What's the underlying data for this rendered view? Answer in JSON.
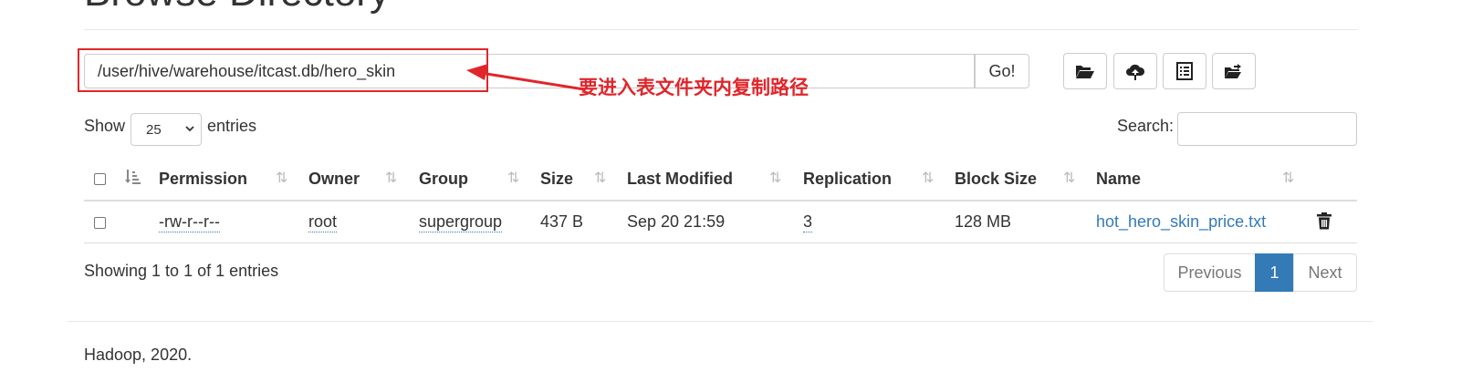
{
  "header": {
    "title": "Browse Directory"
  },
  "pathbar": {
    "path_value": "/user/hive/warehouse/itcast.db/hero_skin",
    "go_label": "Go!"
  },
  "annotation": {
    "text": "要进入表文件夹内复制路径",
    "color": "#e0262b"
  },
  "toolbar": {
    "icons": [
      "folder-open-icon",
      "cloud-upload-icon",
      "list-icon",
      "move-folder-icon"
    ]
  },
  "table_controls": {
    "show_label": "Show",
    "entries_value": "25",
    "entries_label": "entries",
    "search_label": "Search:"
  },
  "table": {
    "columns": [
      "Permission",
      "Owner",
      "Group",
      "Size",
      "Last Modified",
      "Replication",
      "Block Size",
      "Name"
    ],
    "rows": [
      {
        "permission": "-rw-r--r--",
        "owner": "root",
        "group": "supergroup",
        "size": "437 B",
        "last_modified": "Sep 20 21:59",
        "replication": "3",
        "block_size": "128 MB",
        "name": "hot_hero_skin_price.txt"
      }
    ]
  },
  "pagination": {
    "info": "Showing 1 to 1 of 1 entries",
    "previous": "Previous",
    "current": "1",
    "next": "Next"
  },
  "footer": {
    "text": "Hadoop, 2020."
  },
  "colors": {
    "accent": "#337ab7",
    "annotation_red": "#e0262b"
  }
}
